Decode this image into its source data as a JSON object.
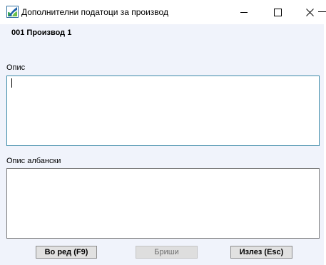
{
  "window": {
    "title": "Дополнителни податоци за производ",
    "accent": "#0a64ad"
  },
  "product": {
    "name": "001 Производ 1"
  },
  "fields": {
    "description_label": "Опис",
    "description_value": "",
    "albanian_label": "Опис албански",
    "albanian_value": ""
  },
  "buttons": {
    "ok_label": "Во ред (F9)",
    "delete_label": "Бриши",
    "exit_label": "Излез (Esc)"
  },
  "icons": {
    "app": "app-logo-icon",
    "minimize": "minimize-icon",
    "maximize": "maximize-icon",
    "close": "close-icon"
  }
}
